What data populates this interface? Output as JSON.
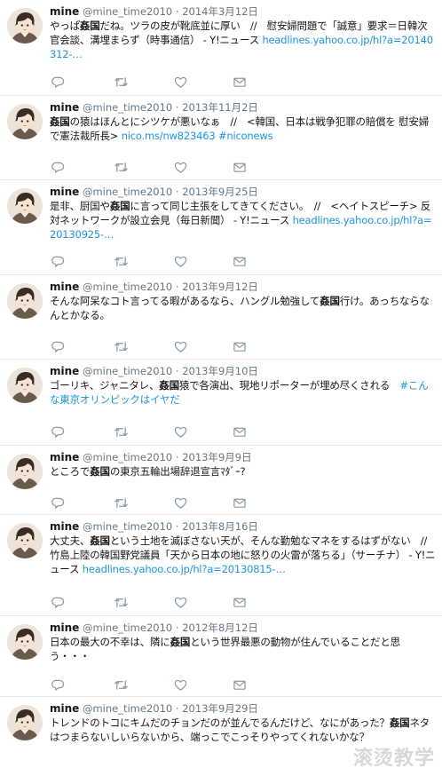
{
  "tweets": [
    {
      "name": "mine",
      "handle": "@mine_time2010",
      "sep": "·",
      "date": "2014年3月12日",
      "segments": [
        {
          "t": "やっぱ"
        },
        {
          "t": "姦国",
          "s": "bold"
        },
        {
          "t": "だね。ツラの皮が靴底並に厚い　//　慰安婦問題で「誠意」要求＝日韓次官会談、溝埋まらず（時事通信） - Y!ニュース "
        },
        {
          "t": "headlines.yahoo.co.jp/hl?a=20140312-…",
          "s": "link"
        }
      ]
    },
    {
      "name": "mine",
      "handle": "@mine_time2010",
      "sep": "·",
      "date": "2013年11月2日",
      "segments": [
        {
          "t": "姦国",
          "s": "bold"
        },
        {
          "t": "の猿はほんとにシツケが悪いなぁ　//　<韓国、日本は戦争犯罪の賠償を 慰安婦で憲法裁所長> "
        },
        {
          "t": "nico.ms/nw823463",
          "s": "link"
        },
        {
          "t": " "
        },
        {
          "t": "#niconews",
          "s": "hashtag"
        }
      ]
    },
    {
      "name": "mine",
      "handle": "@mine_time2010",
      "sep": "·",
      "date": "2013年9月25日",
      "segments": [
        {
          "t": "是非、厨国や"
        },
        {
          "t": "姦国",
          "s": "bold"
        },
        {
          "t": "に言って同じ主張をしてきてください。　//　<ヘイトスピーチ> 反対ネットワークが設立会見（毎日新聞） - Y!ニュース "
        },
        {
          "t": "headlines.yahoo.co.jp/hl?a=20130925-…",
          "s": "link"
        }
      ]
    },
    {
      "name": "mine",
      "handle": "@mine_time2010",
      "sep": "·",
      "date": "2013年9月12日",
      "segments": [
        {
          "t": "そんな阿呆なコト言ってる暇があるなら、ハングル勉強して"
        },
        {
          "t": "姦国",
          "s": "bold"
        },
        {
          "t": "行け。あっちならなんとかなる。"
        }
      ]
    },
    {
      "name": "mine",
      "handle": "@mine_time2010",
      "sep": "·",
      "date": "2013年9月10日",
      "segments": [
        {
          "t": "ゴーリキ、ジャニタレ、"
        },
        {
          "t": "姦国",
          "s": "bold"
        },
        {
          "t": "猿で各演出、現地リポーターが埋め尽くされる　"
        },
        {
          "t": "#こんな東京オリンピックはイヤだ",
          "s": "hashtag"
        }
      ]
    },
    {
      "name": "mine",
      "handle": "@mine_time2010",
      "sep": "·",
      "date": "2013年9月9日",
      "segments": [
        {
          "t": "ところで"
        },
        {
          "t": "姦国",
          "s": "bold"
        },
        {
          "t": "の東京五輪出場辞退宣言ﾏﾀﾞｰ?"
        }
      ]
    },
    {
      "name": "mine",
      "handle": "@mine_time2010",
      "sep": "·",
      "date": "2013年8月16日",
      "segments": [
        {
          "t": "大丈夫、"
        },
        {
          "t": "姦国",
          "s": "bold"
        },
        {
          "t": "という土地を滅ぼさない天が、そんな勤勉なマネをするはずがない　//　竹島上陸の韓国野党議員「天から日本の地に怒りの火雷が落ちる」（サーチナ） - Y!ニュース "
        },
        {
          "t": "headlines.yahoo.co.jp/hl?a=20130815-…",
          "s": "link"
        }
      ]
    },
    {
      "name": "mine",
      "handle": "@mine_time2010",
      "sep": "·",
      "date": "2012年8月12日",
      "segments": [
        {
          "t": "日本の最大の不幸は、隣に"
        },
        {
          "t": "姦国",
          "s": "bold"
        },
        {
          "t": "という世界最悪の動物が住んでいることだと思う・・・"
        }
      ]
    },
    {
      "name": "mine",
      "handle": "@mine_time2010",
      "sep": "·",
      "date": "2013年9月29日",
      "segments": [
        {
          "t": "トレンドのトコにキムだのチョンだのが並んでるんだけど、なにがあった？"
        },
        {
          "t": "姦国",
          "s": "bold"
        },
        {
          "t": "ネタはつまらないしいらないから、端っこでこっそりやってくれないかな？"
        }
      ]
    }
  ],
  "icons": {
    "reply": "reply-icon",
    "retweet": "retweet-icon",
    "like": "heart-icon",
    "mail": "direct-message-icon"
  },
  "colors": {
    "text": "#14171a",
    "secondary": "#657786",
    "link": "#1b95e0",
    "divider": "#e1e8ed"
  },
  "watermark": "滚烫教学"
}
